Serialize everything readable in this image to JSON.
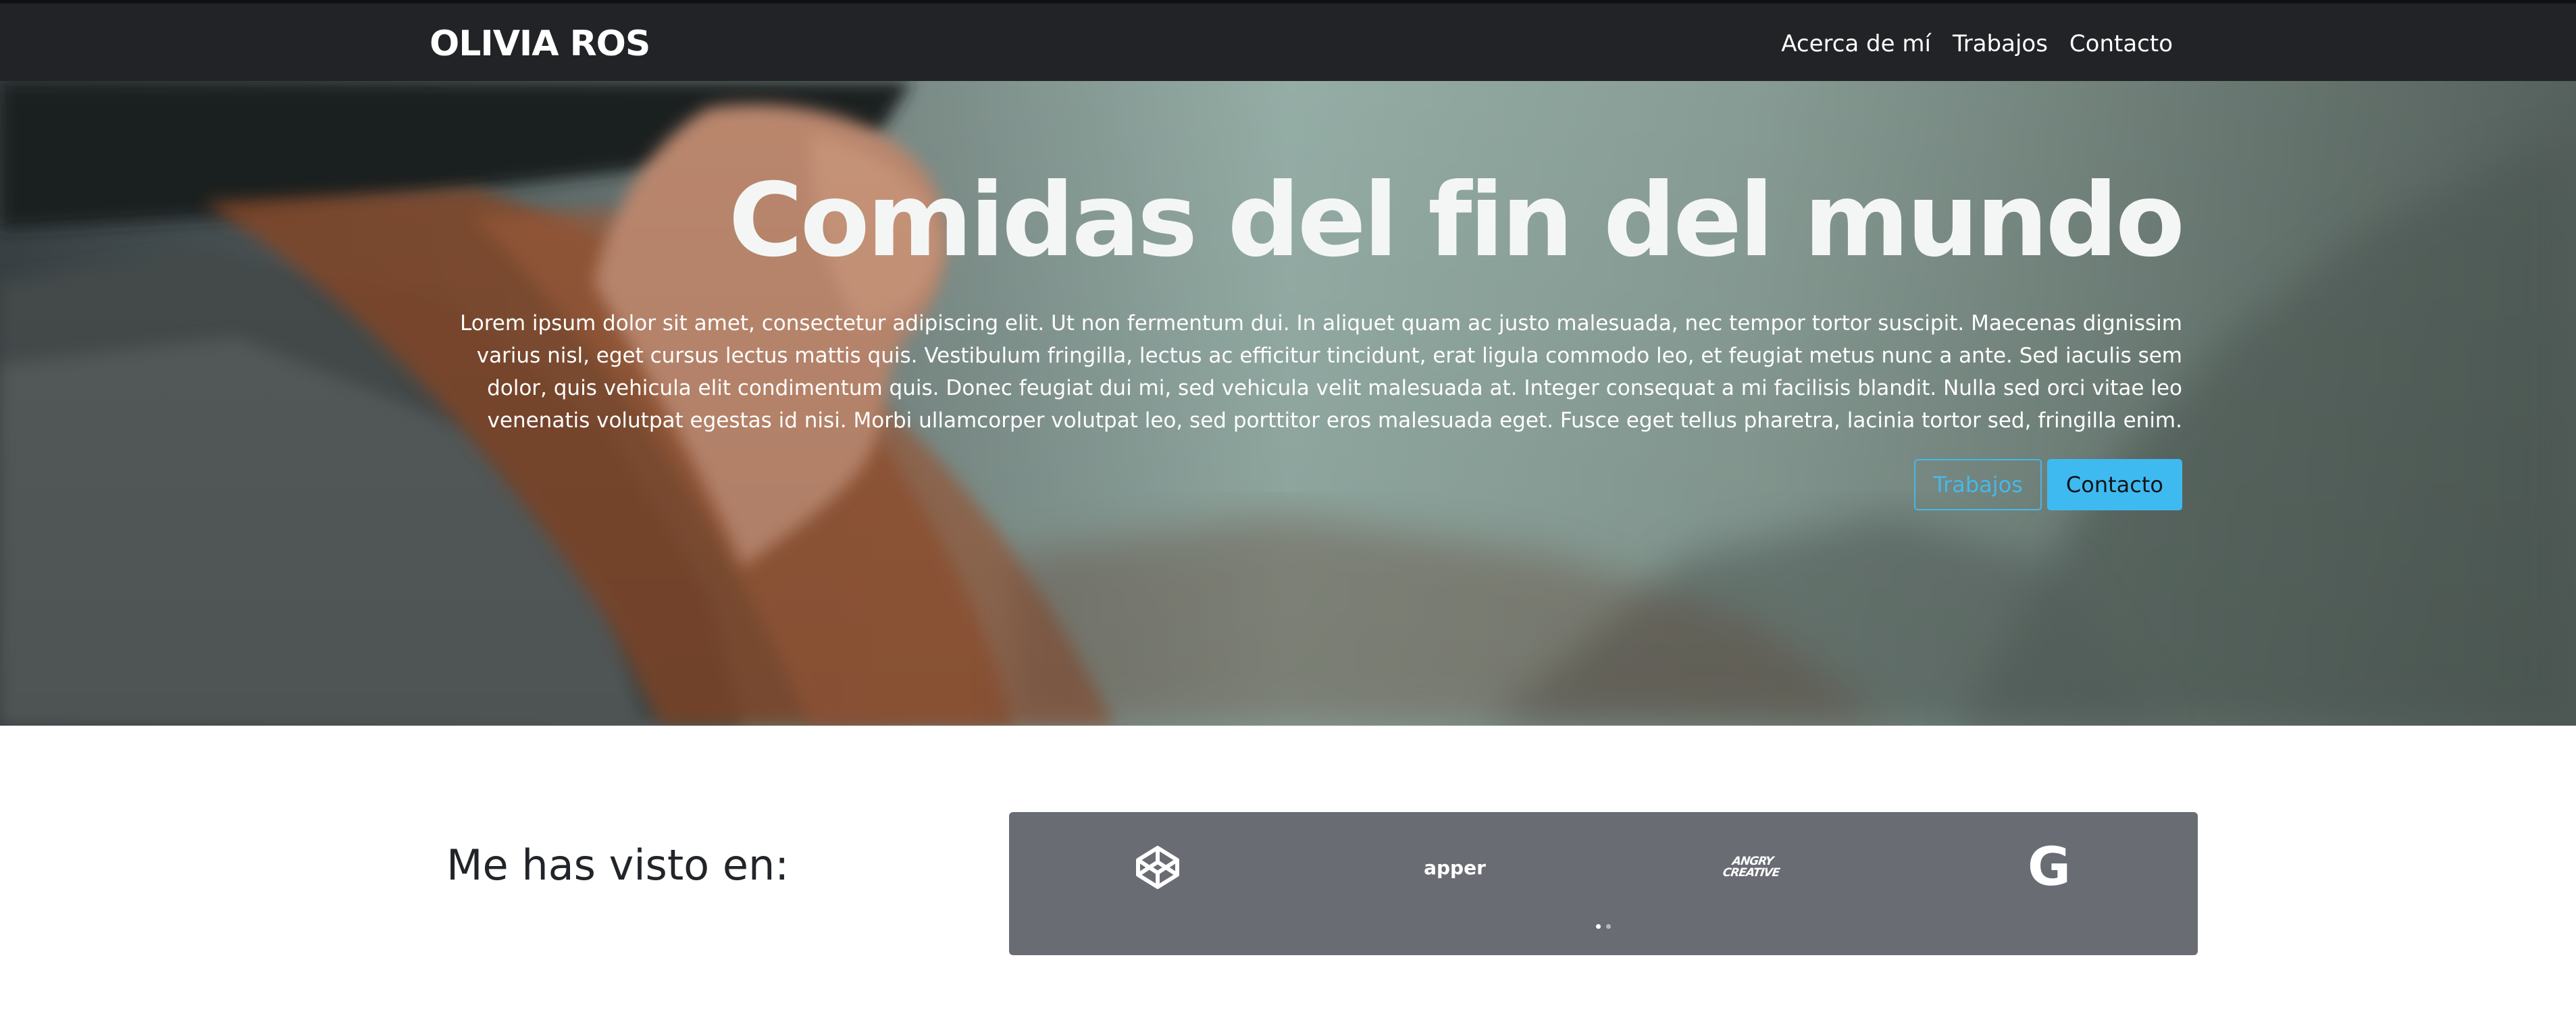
{
  "navbar": {
    "brand": "OLIVIA ROS",
    "links": [
      {
        "label": "Acerca de mí"
      },
      {
        "label": "Trabajos"
      },
      {
        "label": "Contacto"
      }
    ]
  },
  "hero": {
    "title": "Comidas del fin del mundo",
    "lead": "Lorem ipsum dolor sit amet, consectetur adipiscing elit. Ut non fermentum dui. In aliquet quam ac justo malesuada, nec tempor tortor suscipit. Maecenas dignissim varius nisl, eget cursus lectus mattis quis. Vestibulum fringilla, lectus ac efficitur tincidunt, erat ligula commodo leo, et feugiat metus nunc a ante. Sed iaculis sem dolor, quis vehicula elit condimentum quis. Donec feugiat dui mi, sed vehicula velit malesuada at. Integer consequat a mi facilisis blandit. Nulla sed orci vitae leo venenatis volutpat egestas id nisi. Morbi ullamcorper volutpat leo, sed porttitor eros malesuada eget. Fusce eget tellus pharetra, lacinia tortor sed, fringilla enim.",
    "buttons": {
      "works": "Trabajos",
      "contact": "Contacto"
    }
  },
  "seen_on": {
    "heading": "Me has visto en:",
    "logos": [
      {
        "icon": "codepen-icon"
      },
      {
        "text": "apper"
      },
      {
        "text_line1": "ANGRY",
        "text_line2": "CREATIVE"
      },
      {
        "icon": "google-icon",
        "glyph": "G"
      }
    ],
    "carousel": {
      "slides": 2,
      "active": 1
    }
  },
  "colors": {
    "navbar_bg": "#222326",
    "accent": "#3fbaf0",
    "panel_bg": "#696c72",
    "heading_text": "#212529"
  }
}
